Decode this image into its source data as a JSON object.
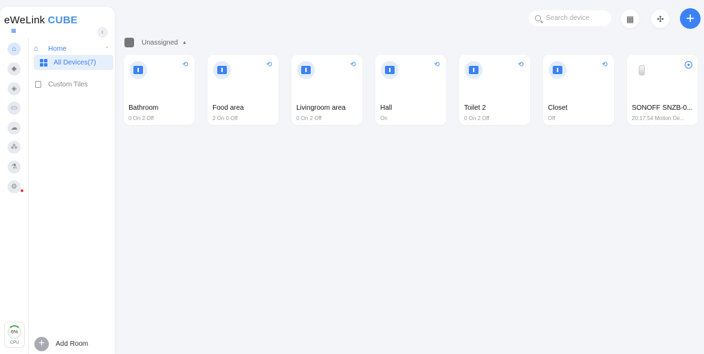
{
  "brand": {
    "name": "eWeLink",
    "accent": "CUBE"
  },
  "nav": {
    "home_label": "Home",
    "all_devices_label": "All Devices(7)",
    "custom_tiles_label": "Custom Tiles",
    "add_room_label": "Add Room"
  },
  "rail_icons": [
    "home-icon",
    "box-icon",
    "shield-icon",
    "camera-icon",
    "cloud-icon",
    "network-icon",
    "lab-icon",
    "gear-icon"
  ],
  "cpu": {
    "value": "6%",
    "label": "CPU"
  },
  "search": {
    "placeholder": "Search device"
  },
  "group": {
    "title": "Unassigned"
  },
  "devices": [
    {
      "name": "Bathroom",
      "status": "0 On 2 Off",
      "icon": "switch-icon"
    },
    {
      "name": "Food area",
      "status": "2 On 0 Off",
      "icon": "switch-icon"
    },
    {
      "name": "Livingroom area",
      "status": "0 On 2 Off",
      "icon": "switch-icon"
    },
    {
      "name": "Hall",
      "status": "On",
      "icon": "switch-icon"
    },
    {
      "name": "Toilet 2",
      "status": "0 On 2 Off",
      "icon": "switch-icon"
    },
    {
      "name": "Closet",
      "status": "Off",
      "icon": "switch-icon"
    },
    {
      "name": "SONOFF SNZB-0...",
      "status": "20:17:54 Motion De...",
      "icon": "motion-sensor-icon"
    }
  ],
  "colors": {
    "accent": "#3b82f6",
    "background": "#f4f5f9",
    "cpu_ring": "#4caf50"
  }
}
